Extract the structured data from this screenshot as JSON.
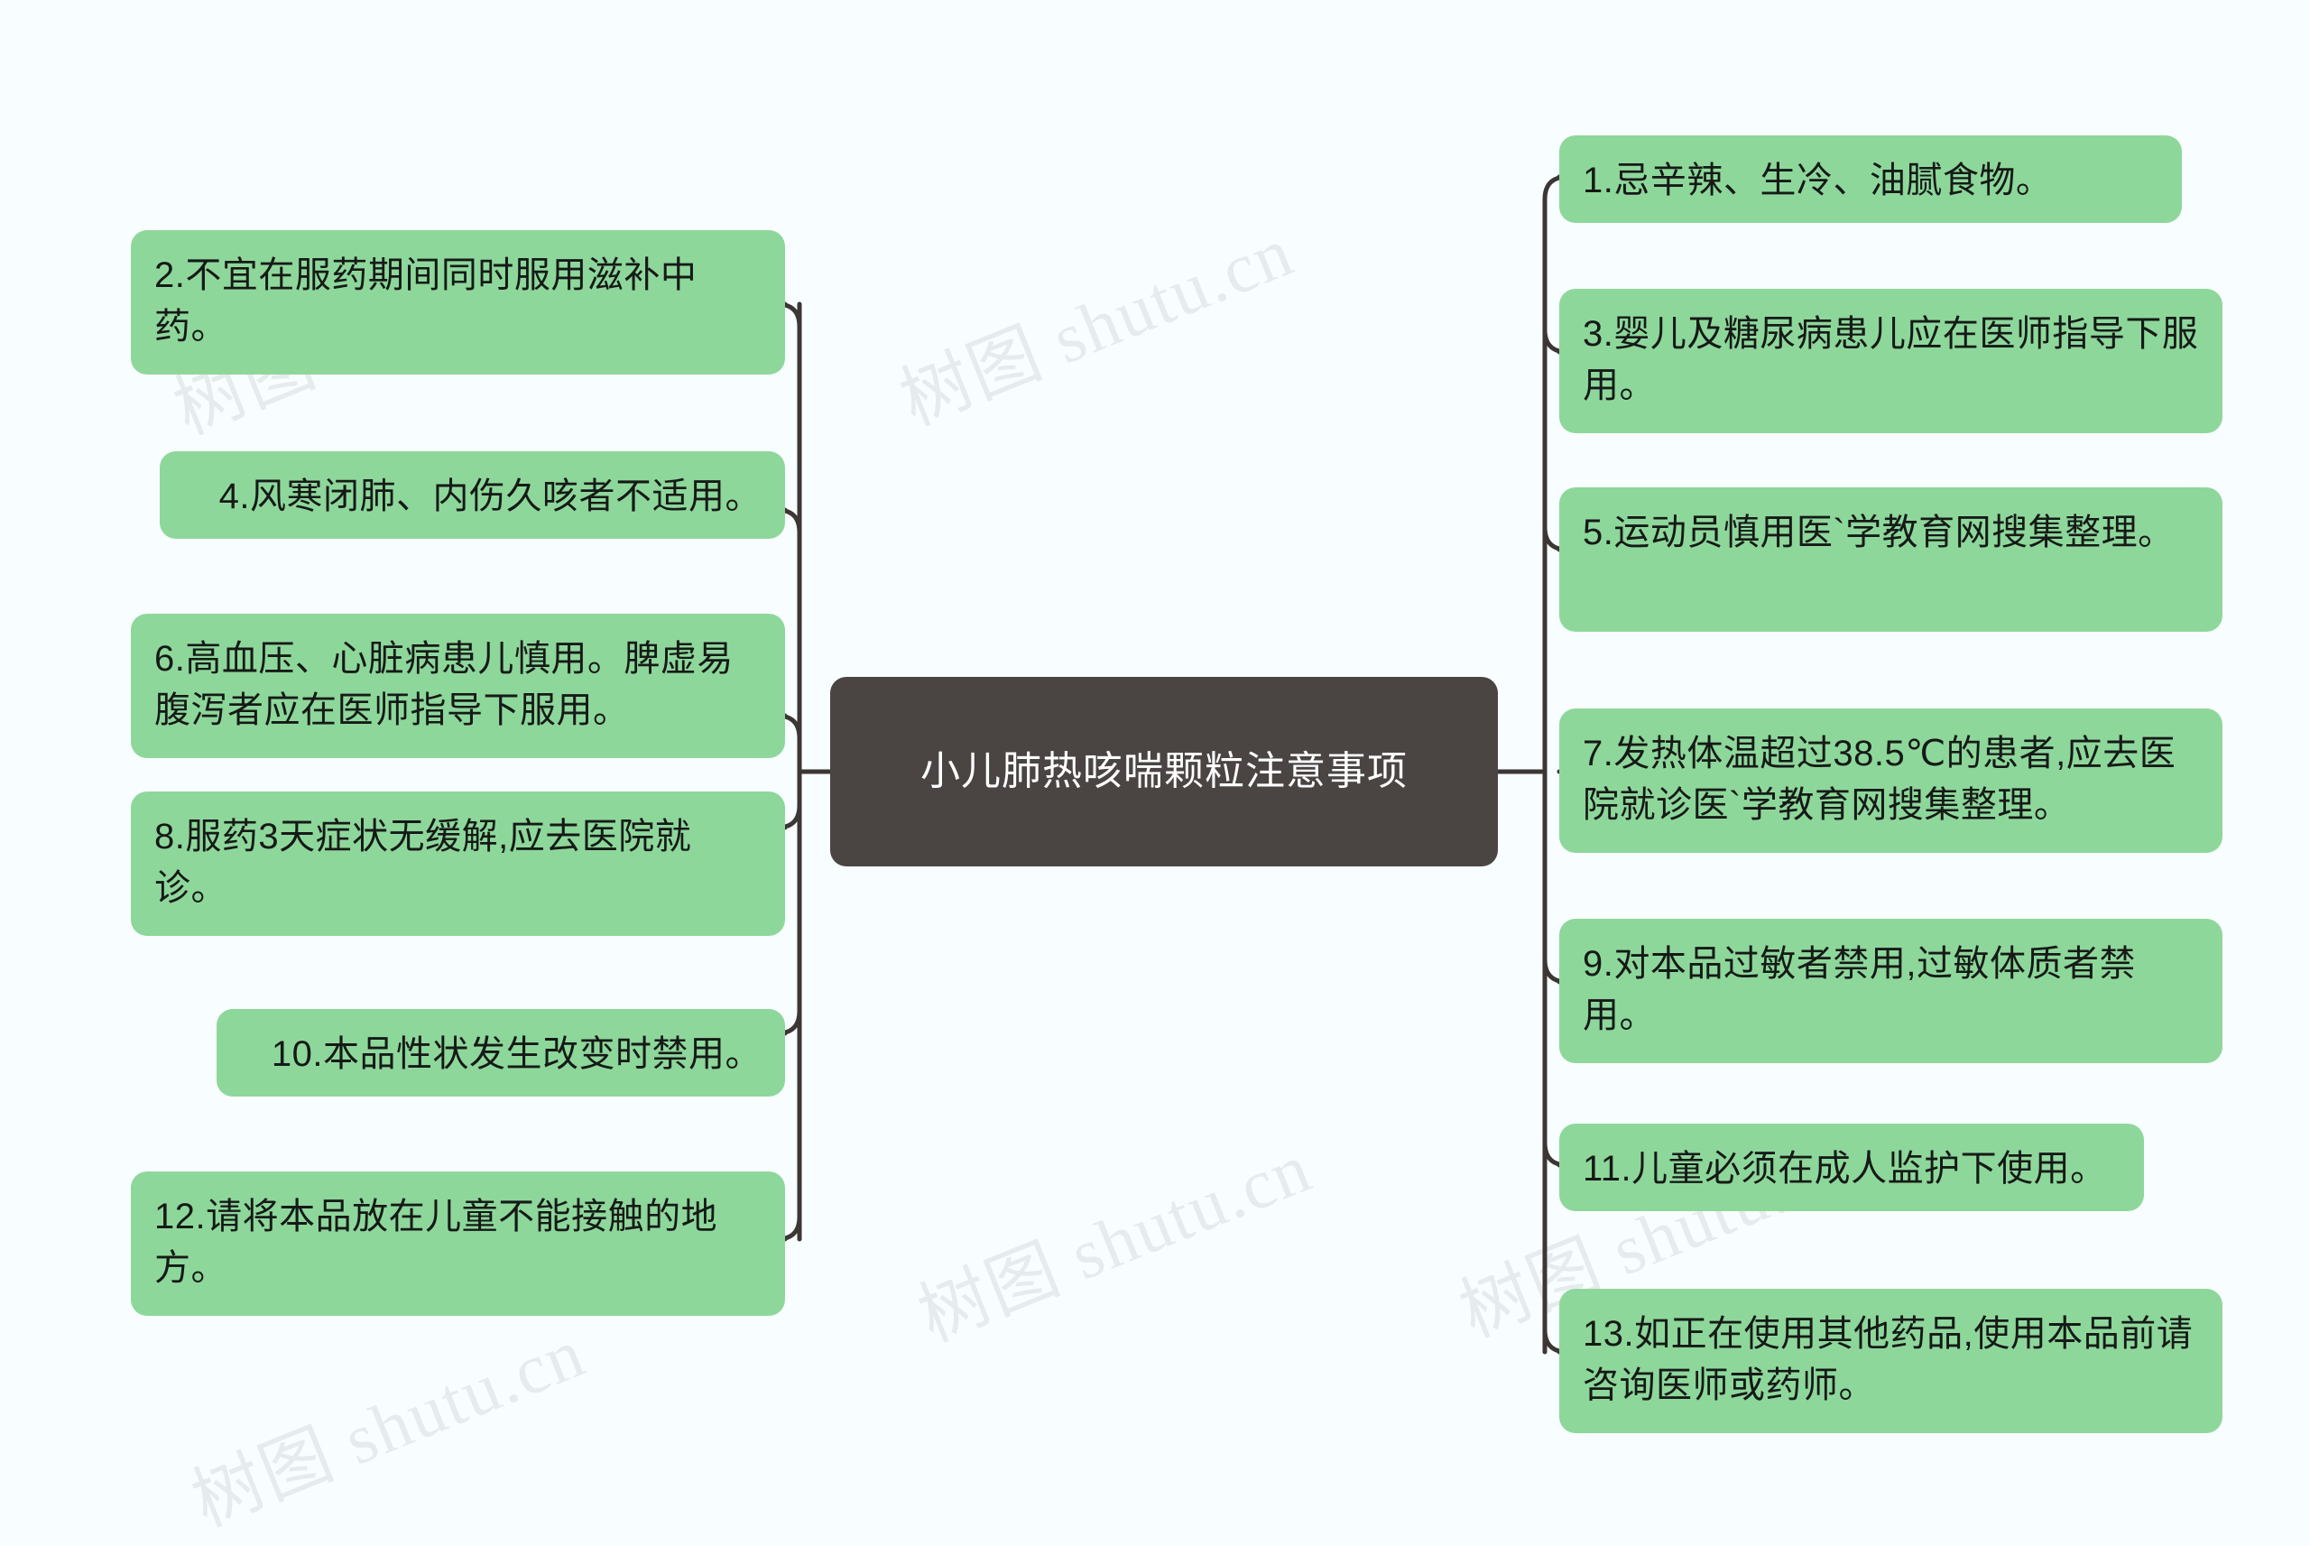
{
  "background_color": "#f8fdff",
  "node_color": "#8ed79b",
  "root_color": "#4a4443",
  "line_color": "#3c3634",
  "root": {
    "label": "小儿肺热咳喘颗粒注意事项"
  },
  "watermarks": [
    {
      "text": "树图 shutu.cn"
    },
    {
      "text": "树图 shutu.cn"
    },
    {
      "text": "树图 shutu.cn"
    },
    {
      "text": "树图 shutu.cn"
    },
    {
      "text": "树图 shutu.cn"
    }
  ],
  "left_branch": [
    {
      "id": 2,
      "label": "2.不宜在服药期间同时服用滋补中药。"
    },
    {
      "id": 4,
      "label": "4.风寒闭肺、内伤久咳者不适用。"
    },
    {
      "id": 6,
      "label": "6.高血压、心脏病患儿慎用。脾虚易腹泻者应在医师指导下服用。"
    },
    {
      "id": 8,
      "label": "8.服药3天症状无缓解,应去医院就诊。"
    },
    {
      "id": 10,
      "label": "10.本品性状发生改变时禁用。"
    },
    {
      "id": 12,
      "label": "12.请将本品放在儿童不能接触的地方。"
    }
  ],
  "right_branch": [
    {
      "id": 1,
      "label": "1.忌辛辣、生冷、油腻食物。"
    },
    {
      "id": 3,
      "label": "3.婴儿及糖尿病患儿应在医师指导下服用。"
    },
    {
      "id": 5,
      "label": "5.运动员慎用医`学教育网搜集整理。"
    },
    {
      "id": 7,
      "label": "7.发热体温超过38.5℃的患者,应去医院就诊医`学教育网搜集整理。"
    },
    {
      "id": 9,
      "label": "9.对本品过敏者禁用,过敏体质者禁用。"
    },
    {
      "id": 11,
      "label": "11.儿童必须在成人监护下使用。"
    },
    {
      "id": 13,
      "label": "13.如正在使用其他药品,使用本品前请咨询医师或药师。"
    }
  ]
}
